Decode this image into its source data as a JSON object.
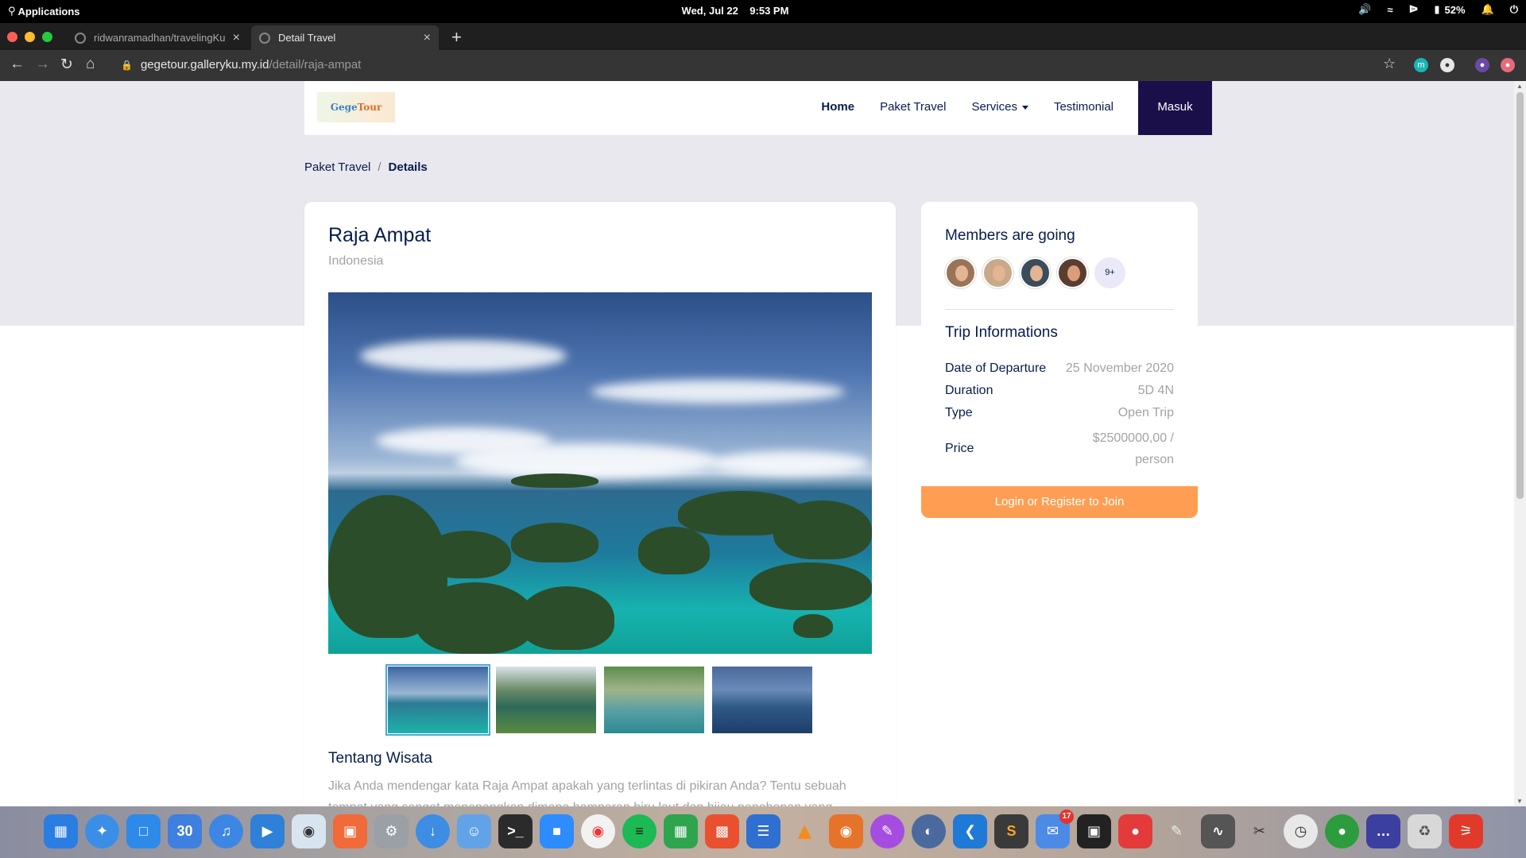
{
  "os_bar": {
    "applications_label": "Applications",
    "date": "Wed, Jul 22",
    "time": "9:53 PM",
    "battery": "52%"
  },
  "browser": {
    "tabs": [
      {
        "title": "ridwanramadhan/travelingKuy",
        "active": false
      },
      {
        "title": "Detail Travel",
        "active": true
      }
    ],
    "url_domain": "gegetour.galleryku.my.id",
    "url_path": "/detail/raja-ampat"
  },
  "site": {
    "logo_text_a": "Gege",
    "logo_text_b": "Tour",
    "nav": {
      "home": "Home",
      "paket_travel": "Paket Travel",
      "services": "Services",
      "testimonial": "Testimonial",
      "masuk": "Masuk"
    },
    "breadcrumb": {
      "parent": "Paket Travel",
      "separator": "/",
      "current": "Details"
    }
  },
  "detail": {
    "title": "Raja Ampat",
    "location": "Indonesia",
    "section_title": "Tentang Wisata",
    "description": "Jika Anda mendengar kata Raja Ampat apakah yang terlintas di pikiran Anda? Tentu sebuah tempat yang sangat menenangkan dimana hamparan biru laut dan hijau pepohonan yang"
  },
  "sidebar": {
    "members_title": "Members are going",
    "members_more": "9+",
    "trip_title": "Trip Informations",
    "trip": [
      {
        "label": "Date of Departure",
        "value": "25 November 2020"
      },
      {
        "label": "Duration",
        "value": "5D 4N"
      },
      {
        "label": "Type",
        "value": "Open Trip"
      },
      {
        "label": "Price",
        "value": "$2500000,00 / person"
      }
    ],
    "join_button": "Login or Register to Join"
  },
  "dock": {
    "calendar_day": "30",
    "mail_badge": "17"
  },
  "colors": {
    "navy": "#071c4d",
    "masuk_bg": "#1b0f4a",
    "join_bg": "#ff9e53",
    "muted": "#a3a3a3"
  }
}
